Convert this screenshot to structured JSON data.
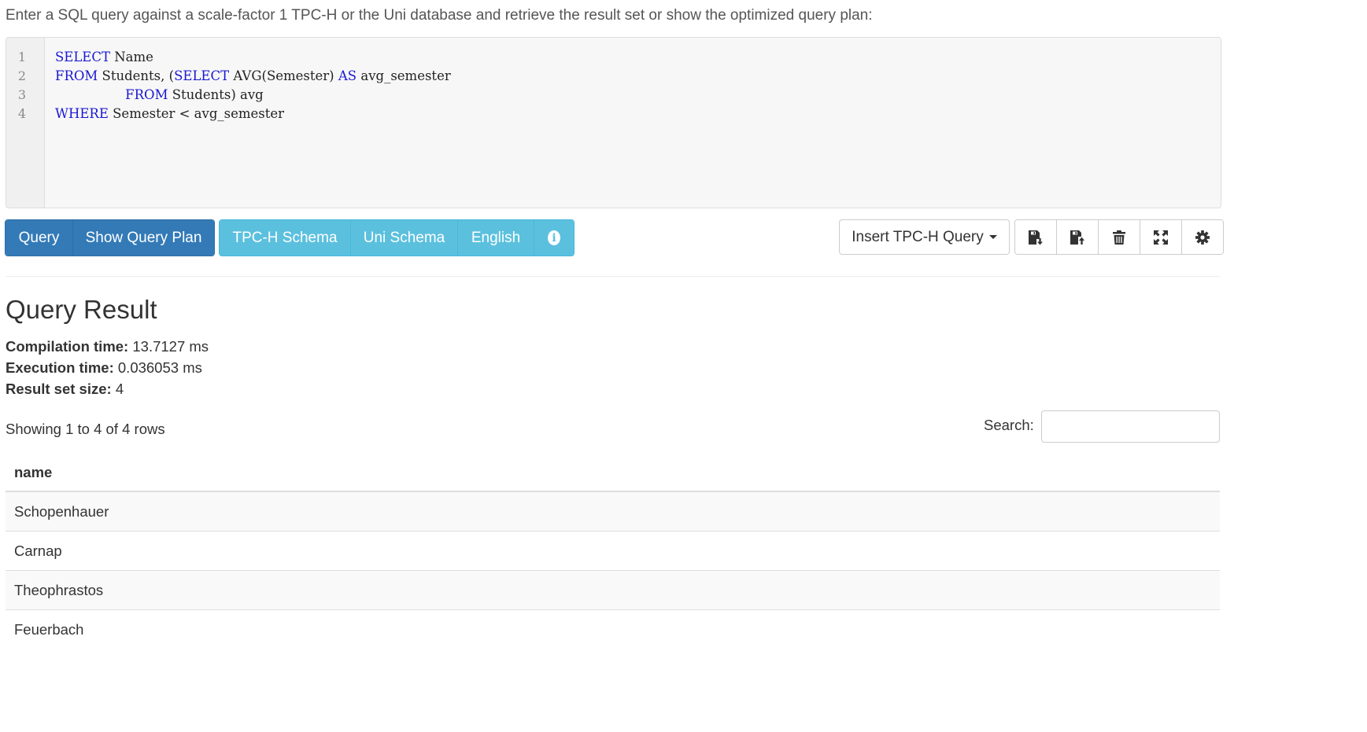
{
  "intro_text": "Enter a SQL query against a scale-factor 1 TPC-H or the Uni database and retrieve the result set or show the optimized query plan:",
  "editor": {
    "line_numbers": [
      "1",
      "2",
      "3",
      "4"
    ],
    "lines": [
      [
        {
          "t": "SELECT",
          "kw": true
        },
        {
          "t": " Name",
          "kw": false
        }
      ],
      [
        {
          "t": "FROM",
          "kw": true
        },
        {
          "t": " Students, (",
          "kw": false
        },
        {
          "t": "SELECT",
          "kw": true
        },
        {
          "t": " AVG(Semester) ",
          "kw": false
        },
        {
          "t": "AS",
          "kw": true
        },
        {
          "t": " avg_semester",
          "kw": false
        }
      ],
      [
        {
          "t": "                 ",
          "kw": false
        },
        {
          "t": "FROM",
          "kw": true
        },
        {
          "t": " Students) avg",
          "kw": false
        }
      ],
      [
        {
          "t": "WHERE",
          "kw": true
        },
        {
          "t": " Semester < avg_semester",
          "kw": false
        }
      ]
    ]
  },
  "toolbar": {
    "query_label": "Query",
    "show_plan_label": "Show Query Plan",
    "tpch_schema_label": "TPC-H Schema",
    "uni_schema_label": "Uni Schema",
    "english_label": "English",
    "info_glyph": "i",
    "insert_query_label": "Insert TPC-H Query",
    "icons": [
      "save-download-icon",
      "save-upload-icon",
      "trash-icon",
      "fullscreen-icon",
      "gear-icon"
    ]
  },
  "result": {
    "title": "Query Result",
    "compilation_label": "Compilation time:",
    "compilation_value": "13.7127 ms",
    "execution_label": "Execution time:",
    "execution_value": "0.036053 ms",
    "size_label": "Result set size:",
    "size_value": "4"
  },
  "table": {
    "showing_text": "Showing 1 to 4 of 4 rows",
    "search_label": "Search:",
    "search_value": "",
    "column_header": "name",
    "rows": [
      "Schopenhauer",
      "Carnap",
      "Theophrastos",
      "Feuerbach"
    ]
  },
  "colors": {
    "primary": "#337ab7",
    "info": "#5bc0de",
    "keyword": "#1a17d1"
  }
}
